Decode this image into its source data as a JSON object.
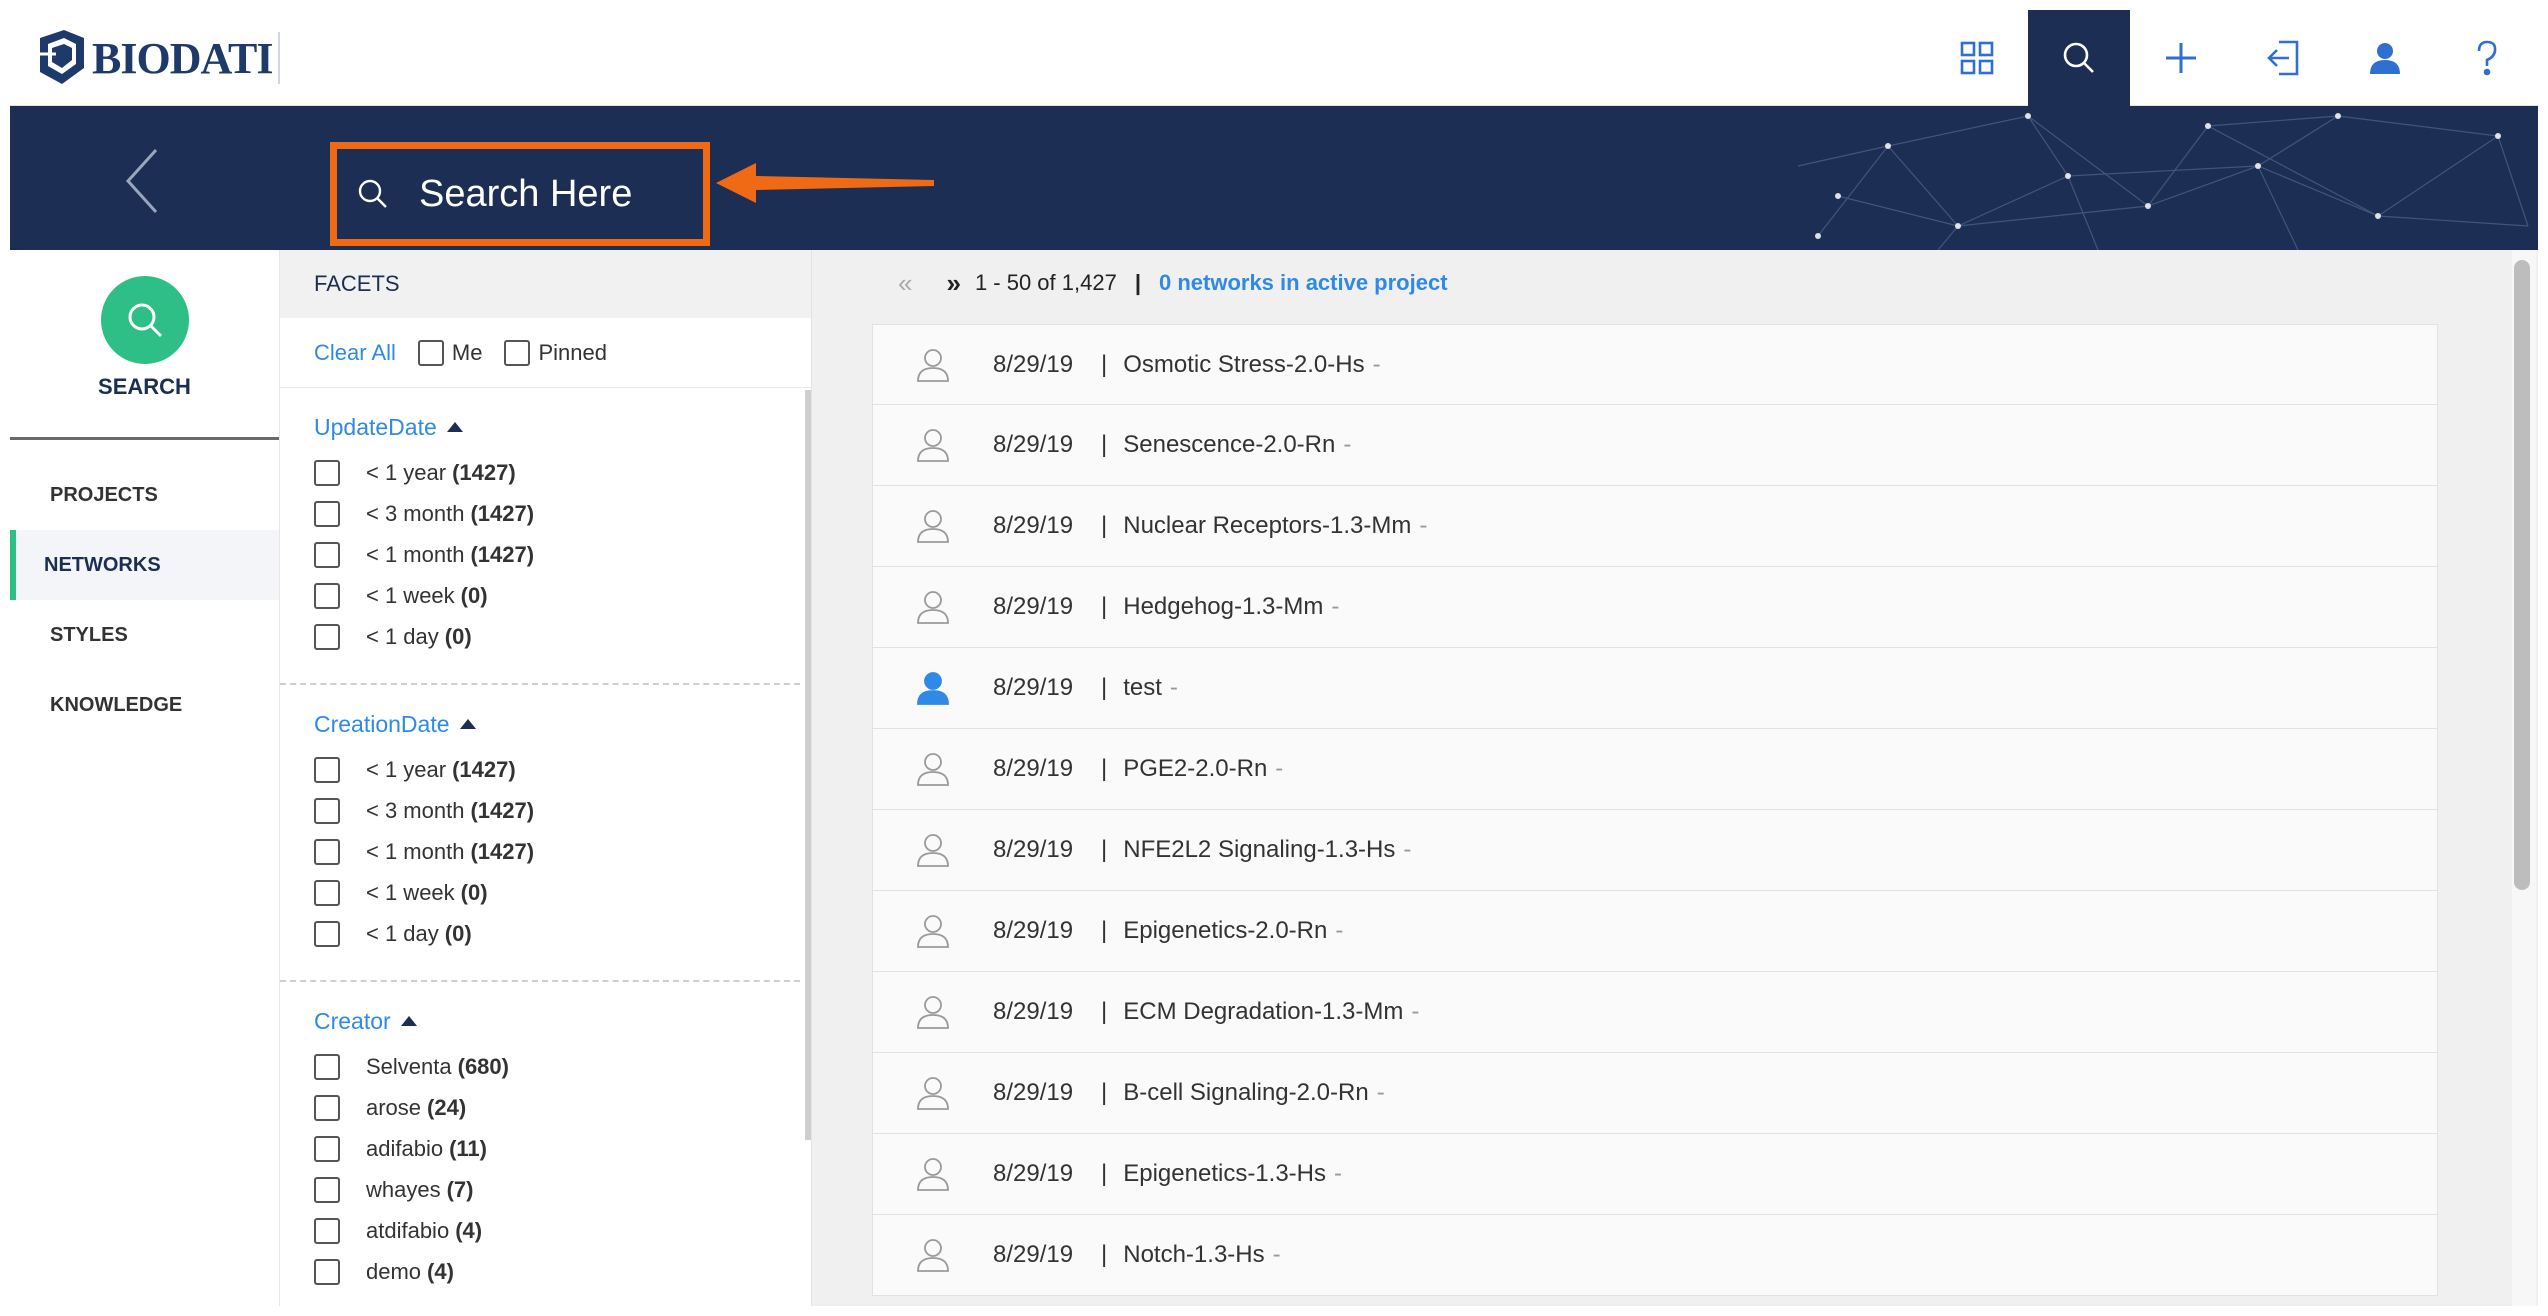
{
  "app": {
    "logo_text": "BIODATI"
  },
  "topbar": {
    "icons": [
      "grid-icon",
      "search-icon",
      "plus-icon",
      "login-icon",
      "user-icon",
      "help-icon"
    ],
    "active_icon": "search-icon"
  },
  "header": {
    "search_placeholder": "Search Here"
  },
  "leftnav": {
    "search_label": "SEARCH",
    "items": [
      {
        "label": "PROJECTS",
        "active": false
      },
      {
        "label": "NETWORKS",
        "active": true
      },
      {
        "label": "STYLES",
        "active": false
      },
      {
        "label": "KNOWLEDGE",
        "active": false
      }
    ]
  },
  "facets": {
    "title": "FACETS",
    "clear_all": "Clear All",
    "me_label": "Me",
    "pinned_label": "Pinned",
    "groups": [
      {
        "title": "UpdateDate",
        "options": [
          {
            "label": "< 1 year",
            "count": "(1427)"
          },
          {
            "label": "< 3 month",
            "count": "(1427)"
          },
          {
            "label": "< 1 month",
            "count": "(1427)"
          },
          {
            "label": "< 1 week",
            "count": "(0)"
          },
          {
            "label": "< 1 day",
            "count": "(0)"
          }
        ]
      },
      {
        "title": "CreationDate",
        "options": [
          {
            "label": "< 1 year",
            "count": "(1427)"
          },
          {
            "label": "< 3 month",
            "count": "(1427)"
          },
          {
            "label": "< 1 month",
            "count": "(1427)"
          },
          {
            "label": "< 1 week",
            "count": "(0)"
          },
          {
            "label": "< 1 day",
            "count": "(0)"
          }
        ]
      },
      {
        "title": "Creator",
        "options": [
          {
            "label": "Selventa",
            "count": "(680)"
          },
          {
            "label": "arose",
            "count": "(24)"
          },
          {
            "label": "adifabio",
            "count": "(11)"
          },
          {
            "label": "whayes",
            "count": "(7)"
          },
          {
            "label": "atdifabio",
            "count": "(4)"
          },
          {
            "label": "demo",
            "count": "(4)"
          }
        ]
      }
    ]
  },
  "results": {
    "prev": "«",
    "next": "»",
    "range": "1 - 50 of 1,427",
    "separator": "|",
    "active_project": "0 networks in active project",
    "rows": [
      {
        "date": "8/29/19",
        "name": "Osmotic Stress-2.0-Hs",
        "owned": false
      },
      {
        "date": "8/29/19",
        "name": "Senescence-2.0-Rn",
        "owned": false
      },
      {
        "date": "8/29/19",
        "name": "Nuclear Receptors-1.3-Mm",
        "owned": false
      },
      {
        "date": "8/29/19",
        "name": "Hedgehog-1.3-Mm",
        "owned": false
      },
      {
        "date": "8/29/19",
        "name": "test",
        "owned": true
      },
      {
        "date": "8/29/19",
        "name": "PGE2-2.0-Rn",
        "owned": false
      },
      {
        "date": "8/29/19",
        "name": "NFE2L2 Signaling-1.3-Hs",
        "owned": false
      },
      {
        "date": "8/29/19",
        "name": "Epigenetics-2.0-Rn",
        "owned": false
      },
      {
        "date": "8/29/19",
        "name": "ECM Degradation-1.3-Mm",
        "owned": false
      },
      {
        "date": "8/29/19",
        "name": "B-cell Signaling-2.0-Rn",
        "owned": false
      },
      {
        "date": "8/29/19",
        "name": "Epigenetics-1.3-Hs",
        "owned": false
      },
      {
        "date": "8/29/19",
        "name": "Notch-1.3-Hs",
        "owned": false
      }
    ],
    "row_separator": "|",
    "row_suffix": "-"
  },
  "colors": {
    "navy": "#1c2e54",
    "accent_orange": "#f06a15",
    "green": "#2dbf85",
    "link_blue": "#2e8ae6"
  }
}
